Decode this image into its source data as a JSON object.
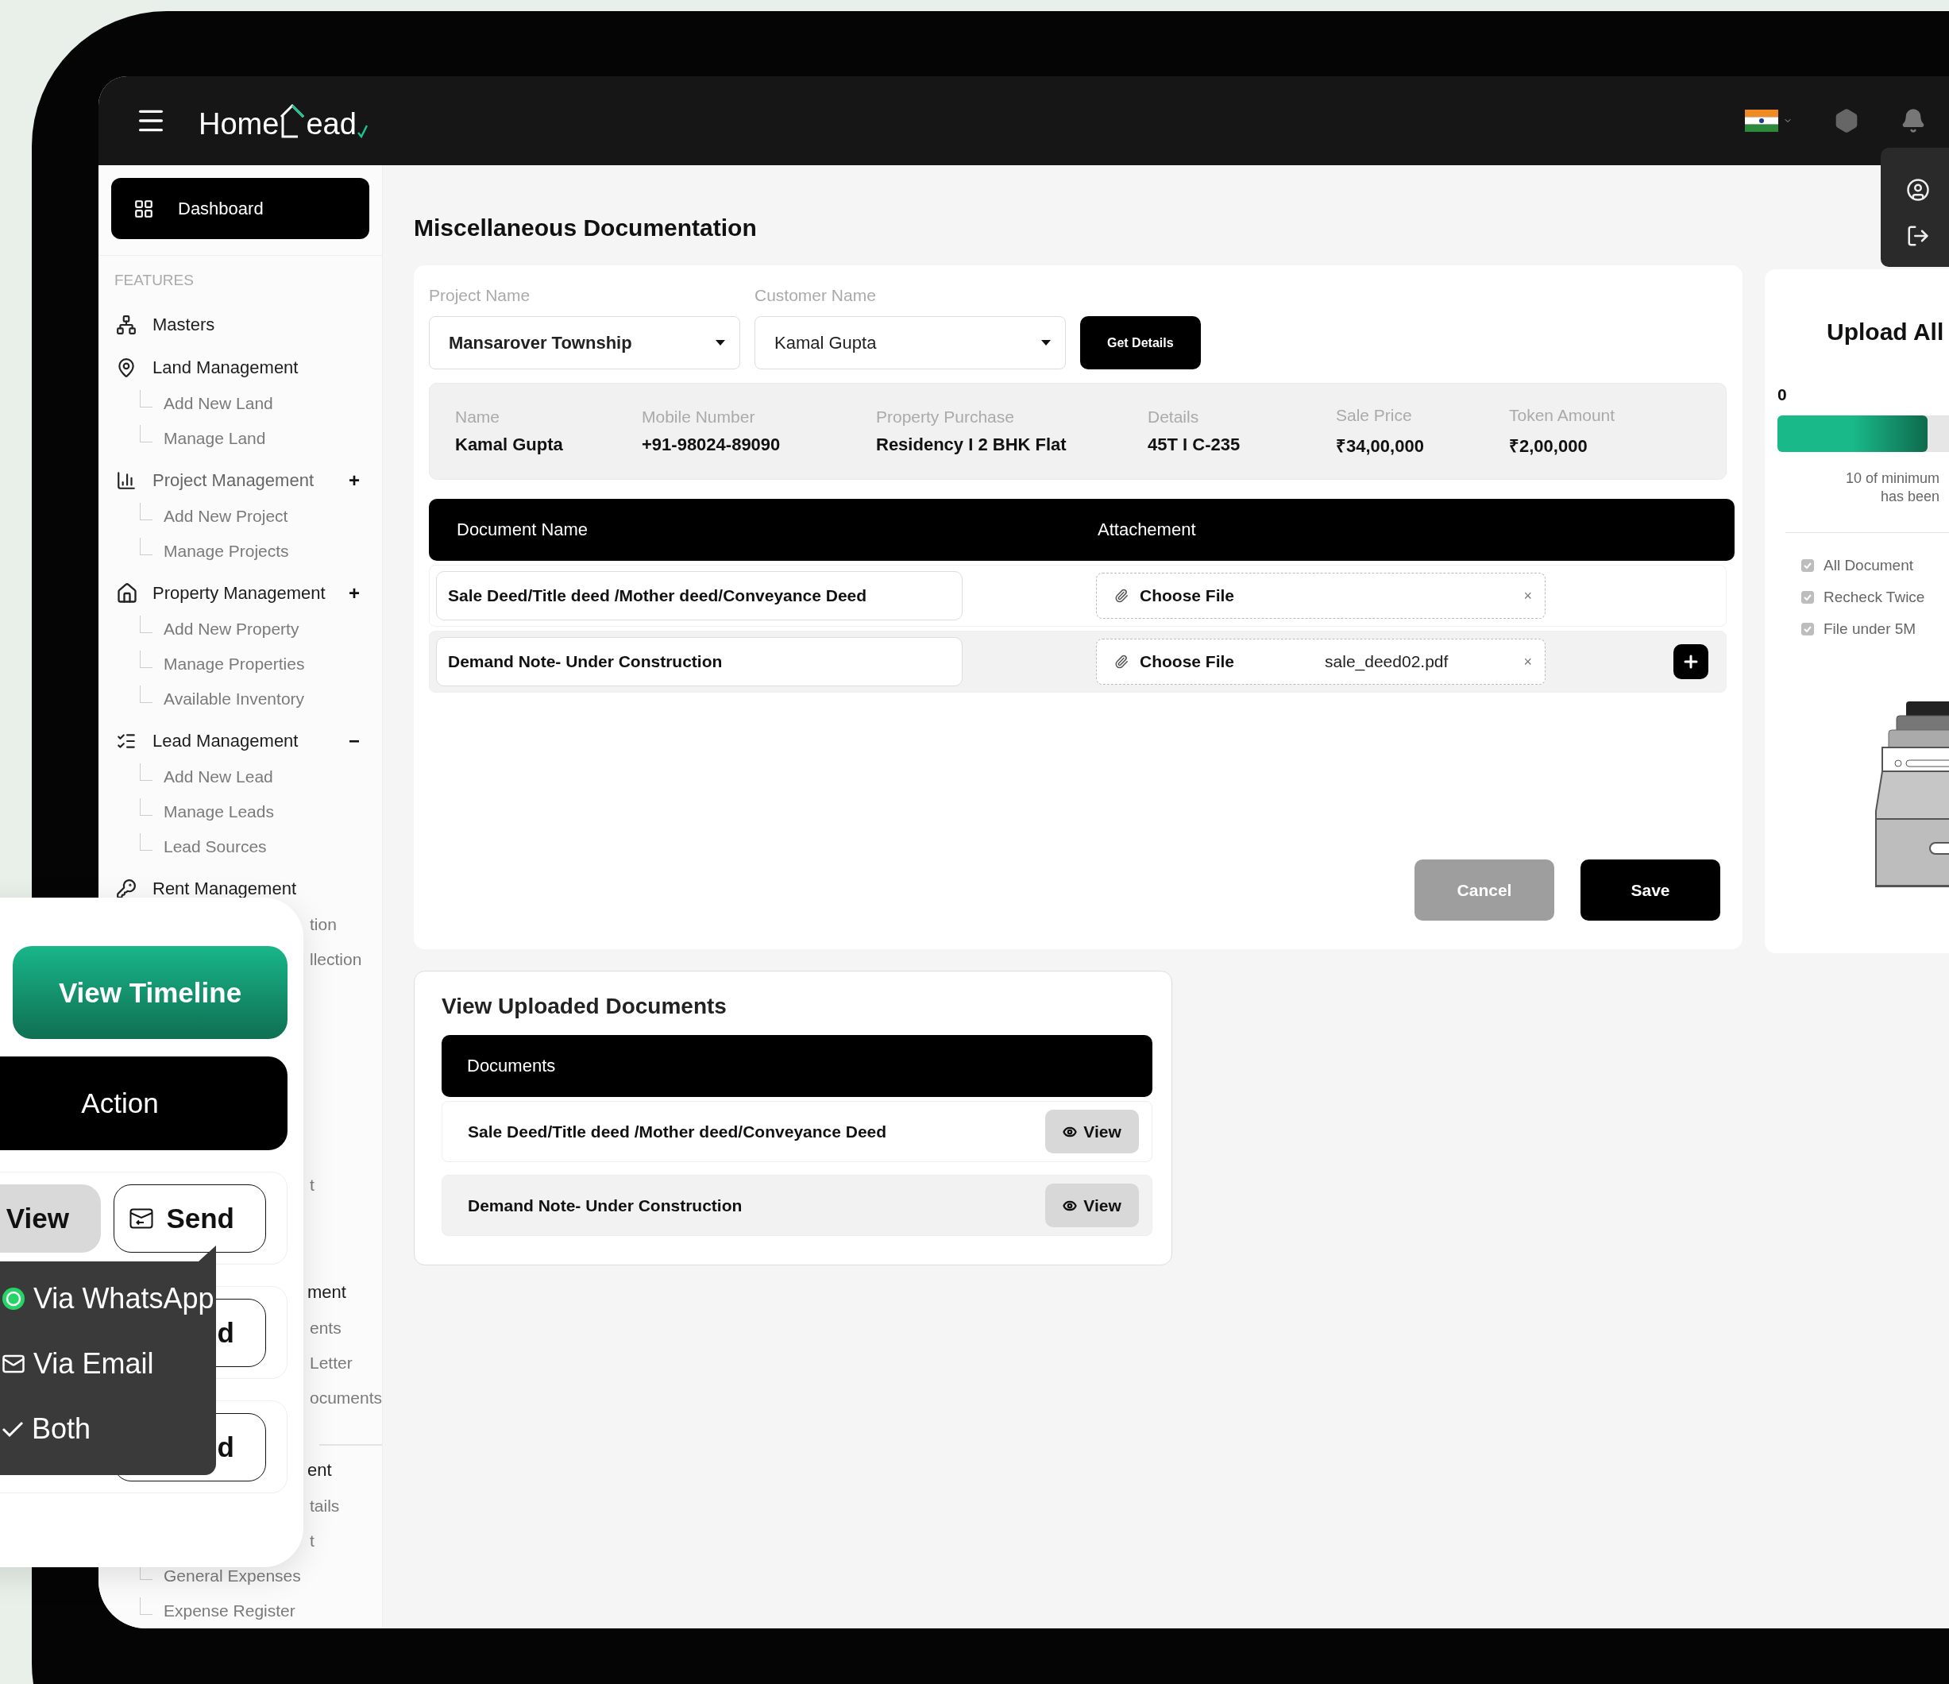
{
  "topbar": {
    "logo": {
      "before": "Home",
      "after": "ead"
    }
  },
  "sidebar": {
    "dashboard": {
      "label": "Dashboard",
      "selected": true
    },
    "section_title": "FEATURES",
    "groups": [
      {
        "label": "Masters",
        "muted": false
      },
      {
        "label": "Land Management",
        "muted": false,
        "children": [
          {
            "label": "Add New Land"
          },
          {
            "label": "Manage Land"
          }
        ]
      },
      {
        "label": "Project Management",
        "toggle": "+",
        "muted": true,
        "children": [
          {
            "label": "Add New Project"
          },
          {
            "label": "Manage Projects"
          }
        ]
      },
      {
        "label": "Property Management",
        "toggle": "+",
        "muted": false,
        "children": [
          {
            "label": "Add New Property"
          },
          {
            "label": "Manage Properties"
          },
          {
            "label": "Available Inventory"
          }
        ]
      },
      {
        "label": "Lead Management",
        "toggle": "−",
        "muted": false,
        "children": [
          {
            "label": "Add New Lead"
          },
          {
            "label": "Manage Leads"
          },
          {
            "label": "Lead Sources"
          }
        ]
      },
      {
        "label": "Rent Management",
        "muted": false,
        "children": [
          {
            "label": "tion",
            "covered": true
          },
          {
            "label": "llection",
            "covered": true
          }
        ]
      },
      {
        "children": [
          {
            "label": "t",
            "covered": true
          }
        ]
      },
      {
        "label": "ment",
        "covered": true,
        "muted": false,
        "children": [
          {
            "label": "ents",
            "covered": true
          },
          {
            "label": "Letter",
            "covered": true
          },
          {
            "label": "ocuments",
            "covered": true
          }
        ]
      },
      {
        "label": "ent",
        "covered": true,
        "muted": false,
        "divider_above": true,
        "children": [
          {
            "label": "tails",
            "covered": true
          },
          {
            "label": "t",
            "covered": true
          },
          {
            "label": "General Expenses"
          },
          {
            "label": "Expense Register"
          }
        ]
      }
    ]
  },
  "page_title": "Miscellaneous Documentation",
  "form": {
    "fields": [
      {
        "label": "Project Name",
        "value": "Mansarover Township"
      },
      {
        "label": "Customer Name",
        "value": "Kamal Gupta"
      }
    ],
    "get_details": "Get Details",
    "summary": [
      {
        "label": "Name",
        "value": "Kamal Gupta"
      },
      {
        "label": "Mobile Number",
        "value": "+91-98024-89090"
      },
      {
        "label": "Property Purchase",
        "value": "Residency I 2 BHK Flat"
      },
      {
        "label": "Details",
        "value": "45T I C-235"
      },
      {
        "label": "Sale Price",
        "value": "₹34,00,000"
      },
      {
        "label": "Token Amount",
        "value": "₹2,00,000"
      }
    ],
    "documents": {
      "columns": [
        "Document Name",
        "Attachement"
      ],
      "rows": [
        {
          "name": "Sale Deed/Title deed /Mother deed/Conveyance Deed",
          "choose": "Choose File",
          "remove": "×",
          "can_add": false
        },
        {
          "name": "Demand Note- Under Construction",
          "choose": "Choose File",
          "file": "sale_deed02.pdf",
          "remove": "×",
          "can_add": true
        }
      ]
    },
    "actions": [
      {
        "label": "Cancel",
        "disabled": true
      },
      {
        "label": "Save",
        "disabled": false
      }
    ]
  },
  "upload_panel": {
    "title": "Upload All",
    "count": "0",
    "progress": {
      "level": 0.45
    },
    "note": [
      "10 of minimum",
      "has been"
    ],
    "checklist": [
      {
        "label": "All Document",
        "checked": true
      },
      {
        "label": "Recheck Twice",
        "checked": true
      },
      {
        "label": "File under 5M",
        "checked": true
      }
    ]
  },
  "uploaded": {
    "title": "View Uploaded Documents",
    "header": "Documents",
    "rows": [
      {
        "name": "Sale Deed/Title deed /Mother deed/Conveyance Deed",
        "action": "View"
      },
      {
        "name": "Demand Note- Under Construction",
        "action": "View"
      }
    ]
  },
  "overlay": {
    "primary": "View Timeline",
    "action": "Action",
    "rows": [
      {
        "view": "View",
        "send": "Send"
      },
      {
        "send": "d"
      },
      {
        "send": "d"
      }
    ],
    "send_menu": [
      {
        "kind": "whatsapp",
        "label": "Via WhatsApp"
      },
      {
        "kind": "email",
        "label": "Via Email"
      },
      {
        "kind": "both",
        "label": "Both"
      }
    ]
  }
}
